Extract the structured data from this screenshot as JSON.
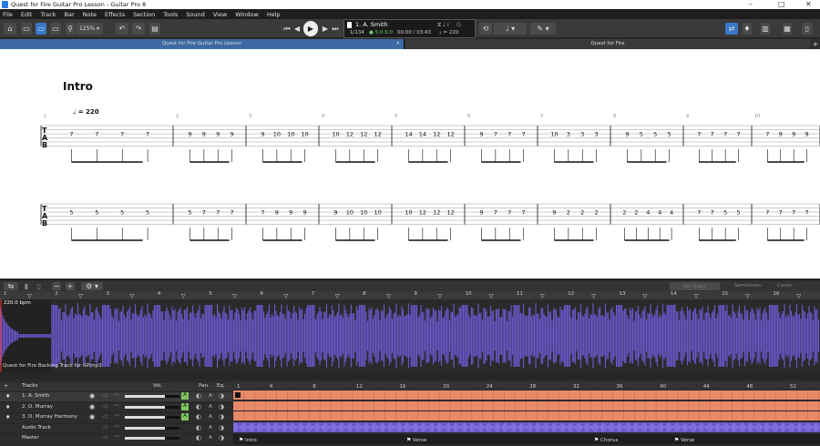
{
  "window": {
    "title": "Quest for Fire Guitar Pro Lesson - Guitar Pro 8"
  },
  "menu": [
    "File",
    "Edit",
    "Track",
    "Bar",
    "Note",
    "Effects",
    "Section",
    "Tools",
    "Sound",
    "View",
    "Window",
    "Help"
  ],
  "toolbar": {
    "zoom": "125%",
    "lcd_track": "1. A. Smith",
    "lcd_bar": "1/134",
    "lcd_sig": "5:0.5:0",
    "lcd_time": "00:00 / 03:43",
    "lcd_tempo": "= 220",
    "lcd_key": "G"
  },
  "tabs": [
    {
      "label": "Quest for Fire Guitar Pro Lesson"
    },
    {
      "label": "Quest for Fire"
    }
  ],
  "score": {
    "section": "Intro",
    "tempo": "= 220",
    "bar_numbers": [
      "1",
      "2",
      "3",
      "4",
      "5",
      "6",
      "7",
      "8",
      "9",
      "10"
    ],
    "staff1": [
      [
        "7",
        "7",
        "7",
        "7"
      ],
      [
        "9",
        "9",
        "9",
        "9"
      ],
      [
        "9",
        "10",
        "10",
        "10"
      ],
      [
        "10",
        "12",
        "12",
        "12"
      ],
      [
        "14",
        "14",
        "12",
        "12"
      ],
      [
        "9",
        "7",
        "7",
        "7"
      ],
      [
        "10",
        "3",
        "3",
        "3"
      ],
      [
        "9",
        "5",
        "5",
        "5"
      ],
      [
        "7",
        "7",
        "7",
        "7"
      ],
      [
        "7",
        "9",
        "9",
        "9"
      ]
    ],
    "staff2": [
      [
        "5",
        "5",
        "5",
        "5"
      ],
      [
        "5",
        "7",
        "7",
        "7"
      ],
      [
        "7",
        "9",
        "9",
        "9"
      ],
      [
        "9",
        "10",
        "10",
        "10"
      ],
      [
        "10",
        "12",
        "12",
        "12"
      ],
      [
        "9",
        "7",
        "7",
        "7"
      ],
      [
        "9",
        "2",
        "2",
        "2"
      ],
      [
        "2",
        "2",
        "4",
        "4",
        "4"
      ],
      [
        "7",
        "7",
        "5",
        "5"
      ],
      [
        "7",
        "7",
        "7",
        "7"
      ]
    ]
  },
  "bottom": {
    "no_video": "No Video",
    "semitones": "Semitones:",
    "cents": "Cents:"
  },
  "audio_ruler": [
    "1",
    "2",
    "3",
    "4",
    "5",
    "6",
    "7",
    "8",
    "9",
    "10",
    "11",
    "12",
    "13",
    "14",
    "15",
    "16"
  ],
  "audio": {
    "tempo": "220.0 bpm",
    "filename": "Quest for Fire Backing Track for GP.mp3"
  },
  "tracks_header": {
    "title": "Tracks",
    "vol": "Vol.",
    "pan": "Pan.",
    "eq": "Eq."
  },
  "tracks": [
    {
      "label": "1. A. Smith"
    },
    {
      "label": "2. D. Murray"
    },
    {
      "label": "3. D. Murray Harmony"
    },
    {
      "label": "Audio Track"
    },
    {
      "label": "Master"
    }
  ],
  "seq_ruler": [
    "1",
    "4",
    "8",
    "12",
    "16",
    "20",
    "24",
    "28",
    "32",
    "36",
    "40",
    "44",
    "48",
    "52"
  ],
  "markers": [
    "Intro",
    "Verse",
    "Chorus",
    "Verse"
  ],
  "colors": {
    "track_orange": "#e8896a",
    "audio_purple": "#6a55c8",
    "accent_blue": "#3a78c8"
  }
}
